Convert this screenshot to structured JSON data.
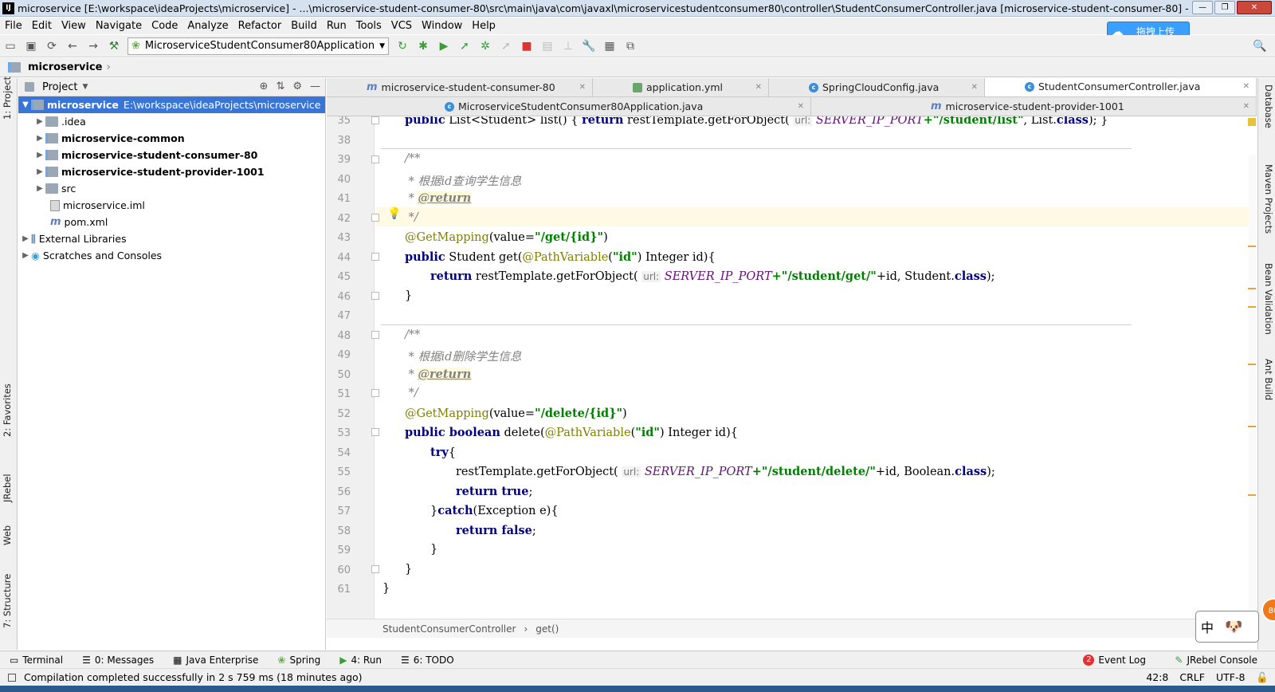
{
  "window": {
    "title": "microservice [E:\\workspace\\ideaProjects\\microservice] - ...\\microservice-student-consumer-80\\src\\main\\java\\com\\javaxl\\microservicestudentconsumer80\\controller\\StudentConsumerController.java [microservice-student-consumer-80] - IntelliJ IDEA (Ad...",
    "app_icon": "IJ",
    "controls": [
      "—",
      "❐",
      "✕"
    ]
  },
  "menu": [
    "File",
    "Edit",
    "View",
    "Navigate",
    "Code",
    "Analyze",
    "Refactor",
    "Build",
    "Run",
    "Tools",
    "VCS",
    "Window",
    "Help"
  ],
  "upload_button": "拖拽上传",
  "toolbar": {
    "run_config": "MicroserviceStudentConsumer80Application"
  },
  "breadcrumb": "microservice",
  "left_tool_tabs": [
    "1: Project",
    "2: Favorites",
    "JRebel",
    "Web",
    "7: Structure"
  ],
  "right_tool_tabs": [
    "Database",
    "Maven Projects",
    "Bean Validation",
    "Ant Build"
  ],
  "project_panel": {
    "title": "Project",
    "tree": [
      {
        "label": "microservice",
        "path": "E:\\workspace\\ideaProjects\\microservice",
        "selected": true
      },
      {
        "label": ".idea"
      },
      {
        "label": "microservice-common"
      },
      {
        "label": "microservice-student-consumer-80"
      },
      {
        "label": "microservice-student-provider-1001"
      },
      {
        "label": "src"
      },
      {
        "label": "microservice.iml"
      },
      {
        "label": "pom.xml"
      },
      {
        "label": "External Libraries"
      },
      {
        "label": "Scratches and Consoles"
      }
    ]
  },
  "editor_tabs": {
    "row1": [
      "microservice-student-consumer-80",
      "application.yml",
      "SpringCloudConfig.java",
      "StudentConsumerController.java"
    ],
    "row2": [
      "MicroserviceStudentConsumer80Application.java",
      "microservice-student-provider-1001"
    ]
  },
  "line_numbers": [
    "35",
    "38",
    "39",
    "40",
    "41",
    "42",
    "43",
    "44",
    "45",
    "46",
    "47",
    "48",
    "49",
    "50",
    "51",
    "52",
    "53",
    "54",
    "55",
    "56",
    "57",
    "58",
    "59",
    "60",
    "61"
  ],
  "code": {
    "l35_kw": "public",
    "l35_a": " List<Student> list() { ",
    "l35_ret": "return",
    "l35_b": " restTemplate.getForObject( ",
    "l35_hint": "url:",
    "l35_fld": " SERVER_IP_PORT",
    "l35_str": "+\"/student/list\"",
    "l35_c": ", List.",
    "l35_cls": "class",
    "l35_d": "); }",
    "l39": "/**",
    "l40": " * 根据id查询学生信息",
    "l41_pre": " * ",
    "l41_tag": "@return",
    "l42": " */",
    "l43_ann": "@GetMapping",
    "l43_a": "(value=",
    "l43_str": "\"/get/{id}\"",
    "l43_b": ")",
    "l44_kw": "public",
    "l44_a": " Student get(",
    "l44_ann": "@PathVariable",
    "l44_b": "(",
    "l44_str": "\"id\"",
    "l44_c": ") Integer id){",
    "l45_kw": "return",
    "l45_a": " restTemplate.getForObject( ",
    "l45_hint": "url:",
    "l45_fld": " SERVER_IP_PORT",
    "l45_str": "+\"/student/get/\"",
    "l45_b": "+id, Student.",
    "l45_cls": "class",
    "l45_c": ");",
    "l46": "}",
    "l48": "/**",
    "l49": " * 根据id删除学生信息",
    "l50_pre": " * ",
    "l50_tag": "@return",
    "l51": " */",
    "l52_ann": "@GetMapping",
    "l52_a": "(value=",
    "l52_str": "\"/delete/{id}\"",
    "l52_b": ")",
    "l53_kw": "public boolean",
    "l53_a": " delete(",
    "l53_ann": "@PathVariable",
    "l53_b": "(",
    "l53_str": "\"id\"",
    "l53_c": ") Integer id){",
    "l54_kw": "try",
    "l54_a": "{",
    "l55_a": "restTemplate.getForObject( ",
    "l55_hint": "url:",
    "l55_fld": " SERVER_IP_PORT",
    "l55_str": "+\"/student/delete/\"",
    "l55_b": "+id, Boolean.",
    "l55_cls": "class",
    "l55_c": ");",
    "l56_kw": "return true",
    "l56_a": ";",
    "l57_a": "}",
    "l57_kw": "catch",
    "l57_b": "(Exception e){",
    "l58_kw": "return false",
    "l58_a": ";",
    "l59": "}",
    "l60": "}",
    "l61": "}"
  },
  "editor_breadcrumb": [
    "StudentConsumerController",
    "get()"
  ],
  "bottom_tabs": [
    "Terminal",
    "0: Messages",
    "Java Enterprise",
    "Spring",
    "4: Run",
    "6: TODO"
  ],
  "bottom_right_tabs": {
    "event_log_count": "2",
    "event_log": "Event Log",
    "jrebel": "JRebel Console"
  },
  "status": {
    "message": "Compilation completed successfully in 2 s 759 ms (18 minutes ago)",
    "position": "42:8",
    "line_sep": "CRLF",
    "encoding": "UTF-8"
  },
  "ime": "中",
  "badge": "80",
  "colors": {
    "selection": "#3875d7",
    "keyword": "#000080",
    "string": "#008000",
    "field": "#660e7a"
  }
}
